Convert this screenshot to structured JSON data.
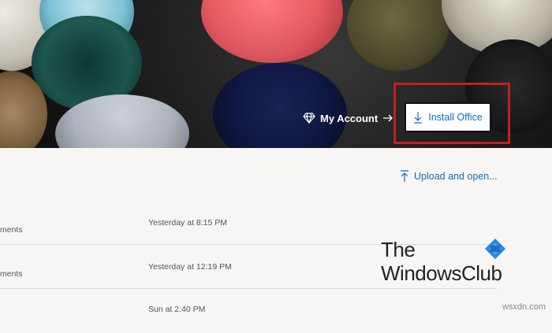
{
  "header": {
    "account_label": "My Account",
    "install_label": "Install Office"
  },
  "content": {
    "upload_label": "Upload and open...",
    "rows": [
      {
        "name": "ments",
        "time": "Yesterday at 8:15 PM"
      },
      {
        "name": "ments",
        "time": "Yesterday at 12:19 PM"
      },
      {
        "name": "",
        "time": "Sun at 2:40 PM"
      }
    ]
  },
  "watermark": {
    "line1": "The",
    "line2": "WindowsClub",
    "site": "wsxdn.com"
  },
  "icons": {
    "account": "diamond-icon",
    "account_arrow": "arrow-right-icon",
    "install": "download-icon",
    "upload": "upload-icon"
  },
  "colors": {
    "accent": "#0f6cbd",
    "highlight": "#c32020",
    "background": "#f7f6f4"
  }
}
